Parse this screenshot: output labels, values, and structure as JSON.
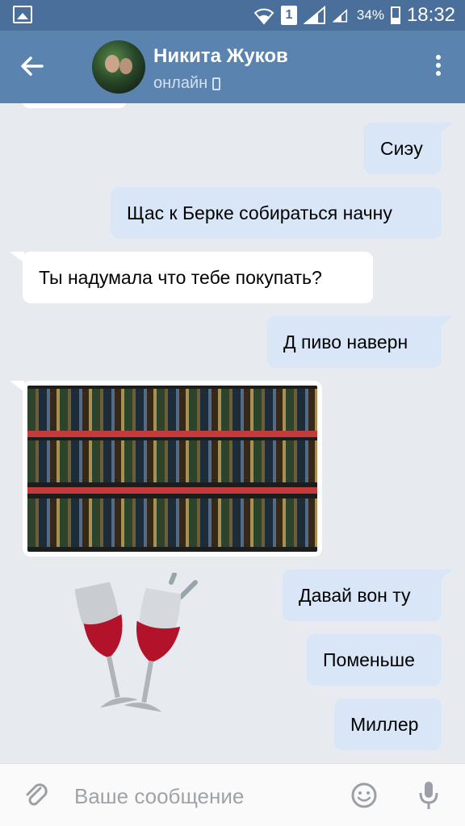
{
  "status_bar": {
    "battery_percent": "34%",
    "time": "18:32",
    "sim_label": "1"
  },
  "header": {
    "contact_name": "Никита Жуков",
    "contact_status": "онлайн"
  },
  "messages": [
    {
      "direction": "outgoing",
      "text": "Сиэу"
    },
    {
      "direction": "outgoing",
      "text": "Щас к Берке собираться начну"
    },
    {
      "direction": "incoming",
      "text": "Ты надумала что тебе покупать?"
    },
    {
      "direction": "outgoing",
      "text": "Д пиво наверн"
    },
    {
      "direction": "incoming",
      "type": "photo"
    },
    {
      "direction": "outgoing",
      "text": "Давай вон ту"
    },
    {
      "direction": "outgoing",
      "text": "Поменьше"
    },
    {
      "direction": "outgoing",
      "text": "Миллер"
    },
    {
      "direction": "incoming",
      "type": "sticker"
    }
  ],
  "input": {
    "placeholder": "Ваше сообщение"
  },
  "icons": {
    "back": "arrow-left-icon",
    "menu": "more-vertical-icon",
    "attach": "paperclip-icon",
    "emoji": "smiley-icon",
    "mic": "microphone-icon"
  },
  "colors": {
    "status_bar": "#4a6f9b",
    "header": "#5b83b0",
    "chat_background": "#e7ebf0",
    "outgoing_bubble": "#d9e6f7",
    "incoming_bubble": "#ffffff"
  }
}
